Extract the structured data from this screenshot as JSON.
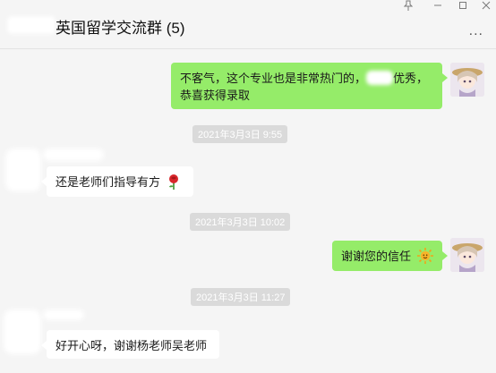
{
  "header": {
    "group_title": "英国留学交流群 (5)",
    "more_label": "...",
    "window_controls": [
      "pin-icon",
      "minimize-icon",
      "maximize-icon",
      "close-icon"
    ]
  },
  "messages": [
    {
      "side": "me",
      "text_part1": "不客气，这个专业也是非常热门的，",
      "text_part2": "优秀，",
      "text_line2": "恭喜获得录取"
    },
    {
      "type": "timestamp",
      "text": "2021年3月3日 9:55"
    },
    {
      "side": "them",
      "text": "还是老师们指导有方",
      "emoji": "rose-icon"
    },
    {
      "type": "timestamp",
      "text": "2021年3月3日 10:02"
    },
    {
      "side": "me",
      "text": "谢谢您的信任",
      "emoji": "sun-icon"
    },
    {
      "type": "timestamp",
      "text": "2021年3月3日 11:27"
    },
    {
      "side": "them",
      "text": "好开心呀，谢谢杨老师吴老师"
    }
  ],
  "colors": {
    "bg": "#f5f5f5",
    "my_bubble": "#95ec69",
    "their_bubble": "#ffffff",
    "timestamp_bg": "#dadada"
  }
}
